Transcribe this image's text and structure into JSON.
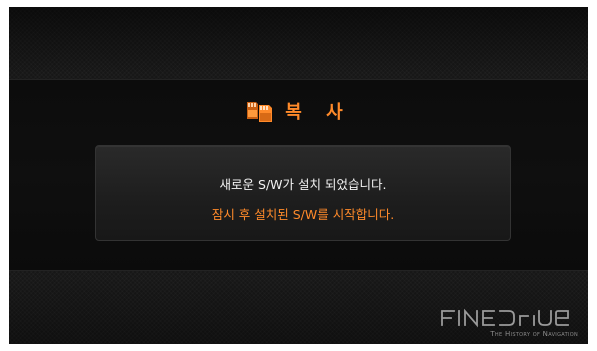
{
  "dialog": {
    "title": "복 사",
    "message_line1": "새로운 S/W가 설치 되었습니다.",
    "message_line2": "잠시 후 설치된 S/W를 시작합니다.",
    "icon": "memory-card-icon"
  },
  "brand": {
    "logo_text": "FINEDrIVE",
    "tagline": "The History of Navigation"
  },
  "colors": {
    "accent": "#ff8a2a",
    "text_primary": "#f2f2f2",
    "background": "#171717",
    "logo": "#9a9a9a"
  }
}
